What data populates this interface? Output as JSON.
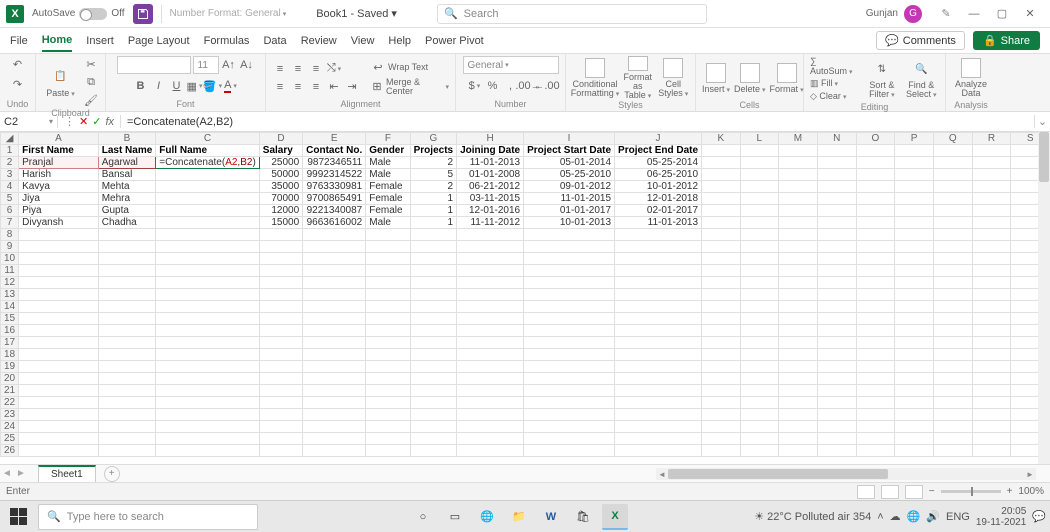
{
  "titlebar": {
    "autosave_label": "AutoSave",
    "autosave_state": "Off",
    "number_format_hint": "Number Format: General",
    "book_title": "Book1 - Saved ▾",
    "search_placeholder": "Search",
    "user_name": "Gunjan",
    "user_initial": "G"
  },
  "tabs": {
    "items": [
      "File",
      "Home",
      "Insert",
      "Page Layout",
      "Formulas",
      "Data",
      "Review",
      "View",
      "Help",
      "Power Pivot"
    ],
    "active": "Home",
    "comments": "Comments",
    "share": "Share"
  },
  "ribbon": {
    "undo": "Undo",
    "clipboard": "Clipboard",
    "paste": "Paste",
    "font": "Font",
    "font_name": "",
    "font_size": "11",
    "alignment": "Alignment",
    "wrap": "Wrap Text",
    "merge": "Merge & Center",
    "number": "Number",
    "number_format": "General",
    "styles": "Styles",
    "cond": "Conditional Formatting",
    "fmt_table": "Format as Table",
    "cell_styles": "Cell Styles",
    "cells": "Cells",
    "insert": "Insert",
    "delete": "Delete",
    "format": "Format",
    "editing": "Editing",
    "autosum": "AutoSum",
    "fill": "Fill",
    "clear": "Clear",
    "sort": "Sort & Filter",
    "find": "Find & Select",
    "analysis": "Analysis",
    "analyze": "Analyze Data"
  },
  "formula_bar": {
    "cell_ref": "C2",
    "formula": "=Concatenate(A2,B2)"
  },
  "columns": [
    "A",
    "B",
    "C",
    "D",
    "E",
    "F",
    "G",
    "H",
    "I",
    "J",
    "K",
    "L",
    "M",
    "N",
    "O",
    "P",
    "Q",
    "R",
    "S"
  ],
  "headers": {
    "A": "First Name",
    "B": "Last Name",
    "C": "Full Name",
    "D": "Salary",
    "E": "Contact No.",
    "F": "Gender",
    "G": "Projects",
    "H": "Joining Date",
    "I": "Project Start Date",
    "J": "Project End Date"
  },
  "rows": [
    {
      "A": "Pranjal",
      "B": "Agarwal",
      "C_edit": "=Concatenate(A2,B2)",
      "D": "25000",
      "E": "9872346511",
      "F": "Male",
      "G": "2",
      "H": "11-01-2013",
      "I": "05-01-2014",
      "J": "05-25-2014"
    },
    {
      "A": "Harish",
      "B": "Bansal",
      "D": "50000",
      "E": "9992314522",
      "F": "Male",
      "G": "5",
      "H": "01-01-2008",
      "I": "05-25-2010",
      "J": "06-25-2010"
    },
    {
      "A": "Kavya",
      "B": "Mehta",
      "D": "35000",
      "E": "9763330981",
      "F": "Female",
      "G": "2",
      "H": "06-21-2012",
      "I": "09-01-2012",
      "J": "10-01-2012"
    },
    {
      "A": "Jiya",
      "B": "Mehra",
      "D": "70000",
      "E": "9700865491",
      "F": "Female",
      "G": "1",
      "H": "03-11-2015",
      "I": "11-01-2015",
      "J": "12-01-2018"
    },
    {
      "A": "Piya",
      "B": "Gupta",
      "D": "12000",
      "E": "9221340087",
      "F": "Female",
      "G": "1",
      "H": "12-01-2016",
      "I": "01-01-2017",
      "J": "02-01-2017"
    },
    {
      "A": "Divyansh",
      "B": "Chadha",
      "D": "15000",
      "E": "9663616002",
      "F": "Male",
      "G": "1",
      "H": "11-11-2012",
      "I": "10-01-2013",
      "J": "11-01-2013"
    }
  ],
  "sheet_tab": "Sheet1",
  "status": {
    "mode": "Enter",
    "zoom": "100%"
  },
  "taskbar": {
    "search_placeholder": "Type here to search",
    "weather": "22°C  Polluted air 354",
    "lang": "ENG",
    "time": "20:05",
    "date": "19-11-2021"
  }
}
